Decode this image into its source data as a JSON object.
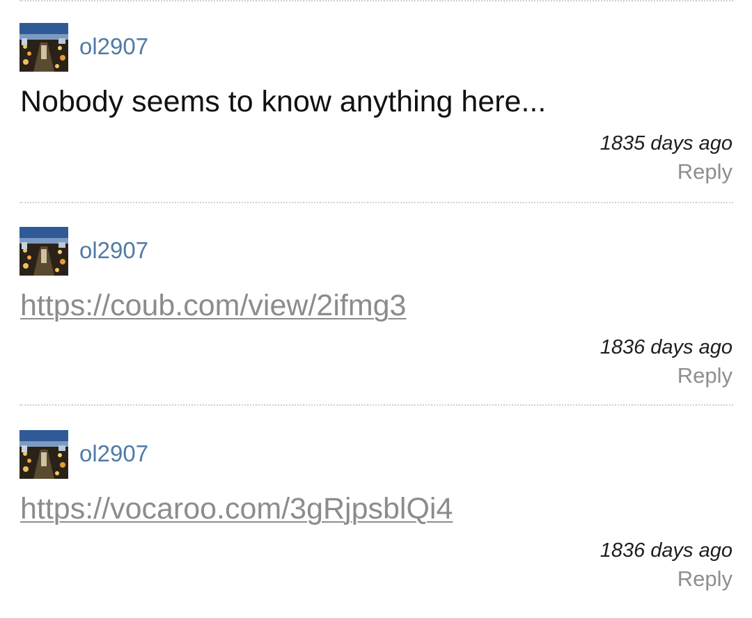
{
  "comments": [
    {
      "username": "ol2907",
      "text": "Nobody seems to know anything here...",
      "is_link": false,
      "time": "1835 days ago",
      "reply_label": "Reply"
    },
    {
      "username": "ol2907",
      "text": "https://coub.com/view/2ifmg3",
      "is_link": true,
      "time": "1836 days ago",
      "reply_label": "Reply"
    },
    {
      "username": "ol2907",
      "text": "https://vocaroo.com/3gRjpsblQi4",
      "is_link": true,
      "time": "1836 days ago",
      "reply_label": "Reply"
    }
  ],
  "colors": {
    "username": "#4f7ba6",
    "link": "#8c8c8c",
    "reply": "#8e8e8e",
    "divider": "#cfcfcf"
  },
  "icons": {
    "avatar": "user-avatar-photo"
  }
}
